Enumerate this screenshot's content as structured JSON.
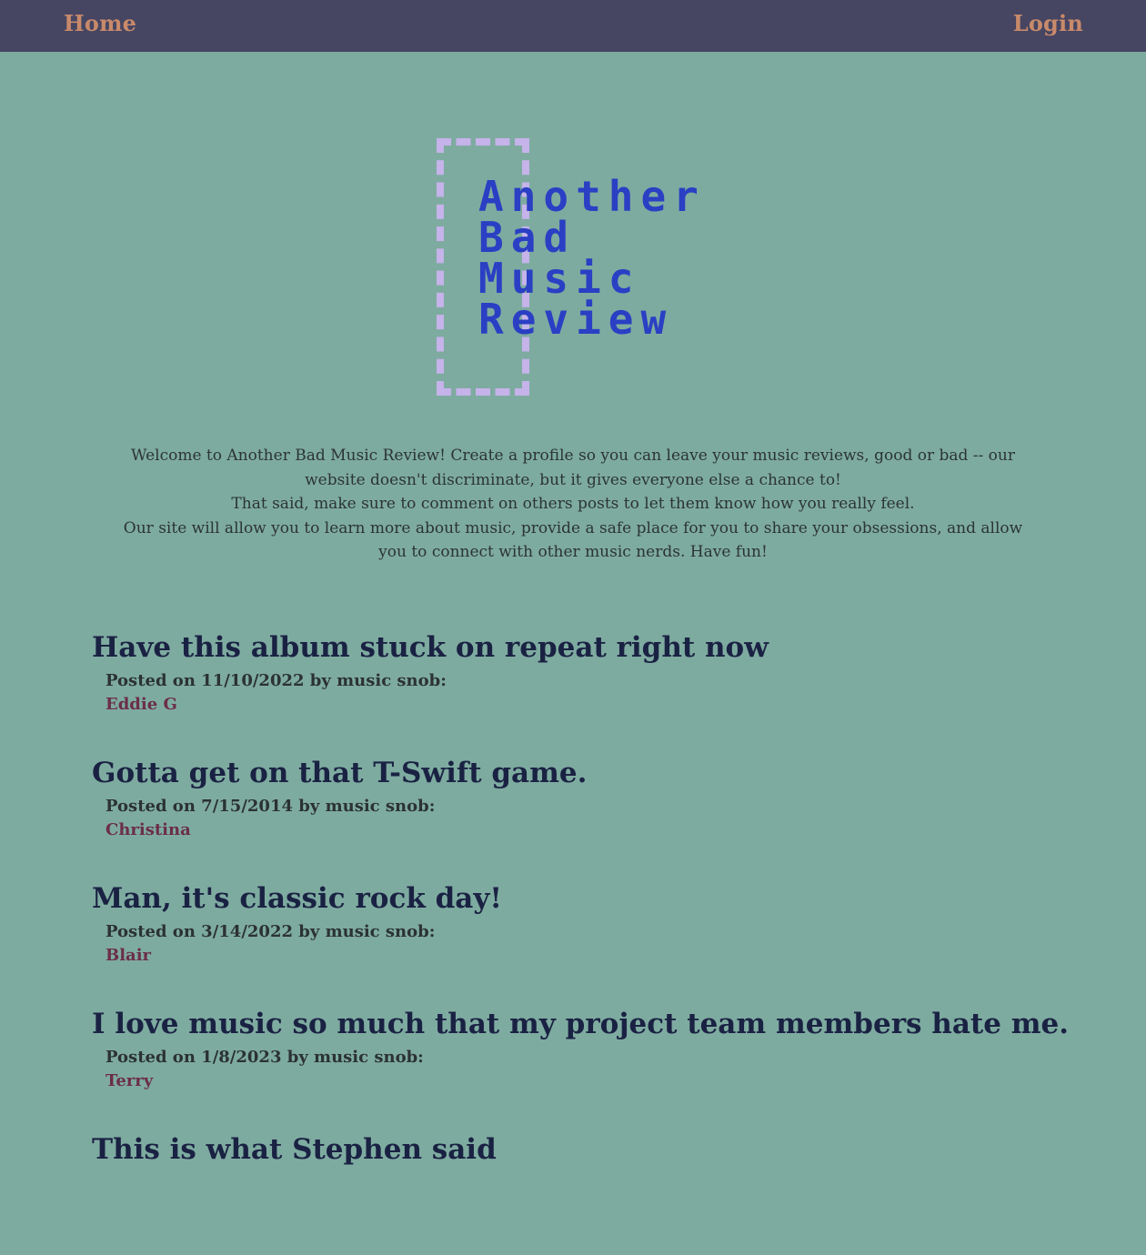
{
  "nav": {
    "home_label": "Home",
    "login_label": "Login"
  },
  "logo": {
    "lines": [
      "Another",
      "Bad",
      "Music",
      "Review"
    ]
  },
  "intro": {
    "paragraph1": "Welcome to Another Bad Music Review! Create a profile so you can leave your music reviews, good or bad -- our website doesn't discriminate, but it gives everyone else a chance to!",
    "paragraph2": "That said, make sure to comment on others posts to let them know how you really feel.",
    "paragraph3": "Our site will allow you to learn more about music, provide a safe place for you to share your obsessions, and allow you to connect with other music nerds. Have fun!"
  },
  "posts": [
    {
      "title": "Have this album stuck on repeat right now",
      "meta": "Posted on 11/10/2022 by music snob:",
      "author": "Eddie G"
    },
    {
      "title": "Gotta get on that T-Swift game.",
      "meta": "Posted on 7/15/2014 by music snob:",
      "author": "Christina"
    },
    {
      "title": "Man, it's classic rock day!",
      "meta": "Posted on 3/14/2022 by music snob:",
      "author": "Blair"
    },
    {
      "title": "I love music so much that my project team members hate me.",
      "meta": "Posted on 1/8/2023 by music snob:",
      "author": "Terry"
    },
    {
      "title": "This is what Stephen said",
      "meta": "",
      "author": ""
    }
  ],
  "colors": {
    "background": "#7eaba0",
    "nav_background": "#464562",
    "nav_link": "#c88a6a",
    "logo_text": "#2a3fc4",
    "logo_bracket": "#c5b3ea",
    "post_title": "#1a2243",
    "post_author": "#6b2e48"
  }
}
